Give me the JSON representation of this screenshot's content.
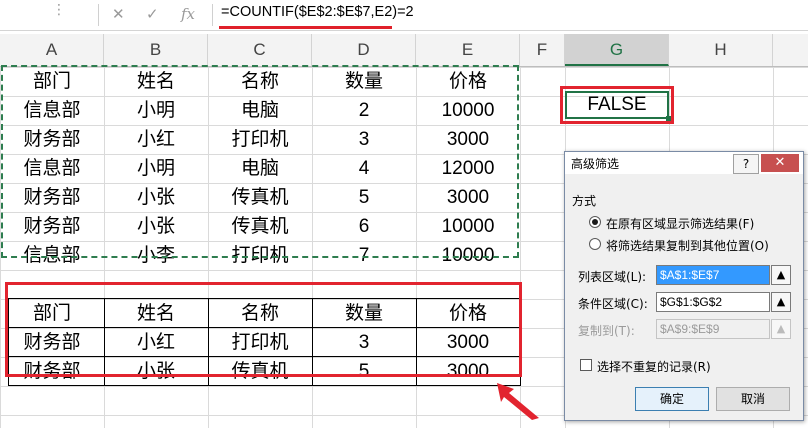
{
  "formula_bar": {
    "cancel_icon": "✕",
    "enter_icon": "✓",
    "fx_label": "fx",
    "formula": "=COUNTIF($E$2:$E$7,E2)=2"
  },
  "columns": [
    "A",
    "B",
    "C",
    "D",
    "E",
    "F",
    "G",
    "H"
  ],
  "source_table": {
    "headers": [
      "部门",
      "姓名",
      "名称",
      "数量",
      "价格"
    ],
    "rows": [
      [
        "信息部",
        "小明",
        "电脑",
        "2",
        "10000"
      ],
      [
        "财务部",
        "小红",
        "打印机",
        "3",
        "3000"
      ],
      [
        "信息部",
        "小明",
        "电脑",
        "4",
        "12000"
      ],
      [
        "财务部",
        "小张",
        "传真机",
        "5",
        "3000"
      ],
      [
        "财务部",
        "小张",
        "传真机",
        "6",
        "10000"
      ],
      [
        "信息部",
        "小李",
        "打印机",
        "7",
        "10000"
      ]
    ]
  },
  "result_table": {
    "headers": [
      "部门",
      "姓名",
      "名称",
      "数量",
      "价格"
    ],
    "rows": [
      [
        "财务部",
        "小红",
        "打印机",
        "3",
        "3000"
      ],
      [
        "财务部",
        "小张",
        "传真机",
        "5",
        "3000"
      ]
    ]
  },
  "criteria_cell": {
    "value": "FALSE"
  },
  "dialog": {
    "title": "高级筛选",
    "help_icon": "?",
    "close_icon": "✕",
    "method_label": "方式",
    "option1": "在原有区域显示筛选结果(F)",
    "option2": "将筛选结果复制到其他位置(O)",
    "list_range_label": "列表区域(L):",
    "list_range_value": "$A$1:$E$7",
    "criteria_range_label": "条件区域(C):",
    "criteria_range_value": "$G$1:$G$2",
    "copy_to_label": "复制到(T):",
    "copy_to_value": "$A$9:$E$9",
    "unique_label": "选择不重复的记录(R)",
    "ok_label": "确定",
    "cancel_label": "取消"
  },
  "colors": {
    "accent_red": "#e2242f",
    "excel_green": "#217346"
  }
}
